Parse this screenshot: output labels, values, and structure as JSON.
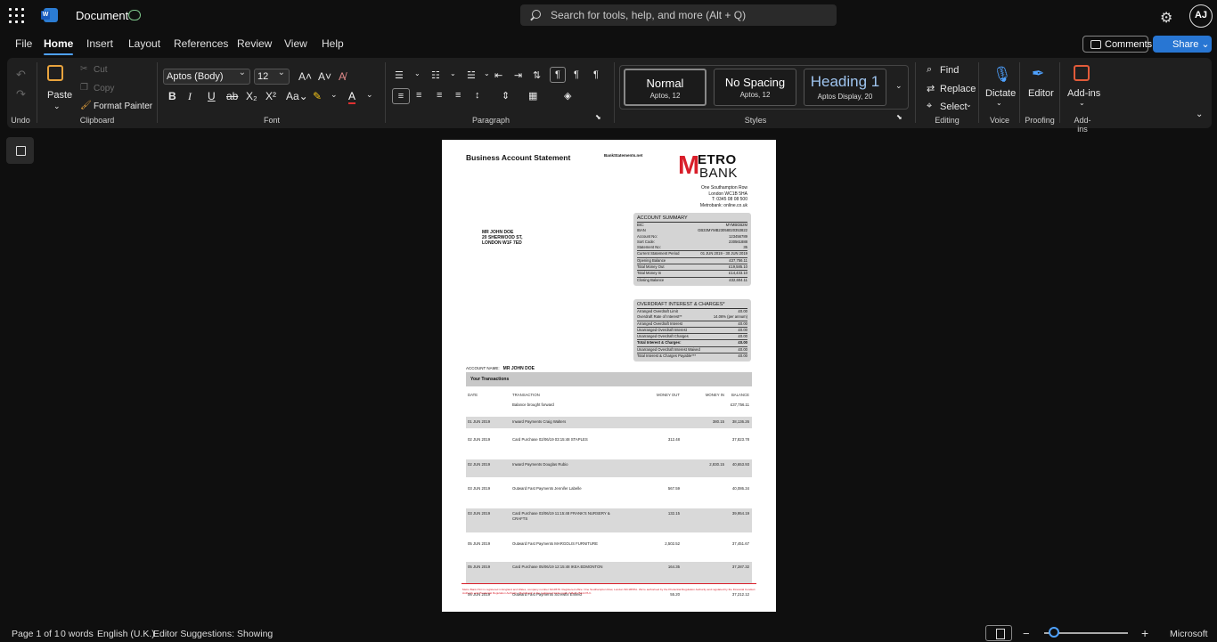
{
  "app": {
    "doc_title": "Document",
    "search_placeholder": "Search for tools, help, and more (Alt + Q)",
    "avatar": "AJ",
    "brand_color": "#2876d3"
  },
  "tabs": [
    "File",
    "Home",
    "Insert",
    "Layout",
    "References",
    "Review",
    "View",
    "Help"
  ],
  "active_tab": "Home",
  "top_buttons": {
    "comments": "Comments",
    "share": "Share"
  },
  "ribbon": {
    "undo_group": "Undo",
    "clipboard": {
      "paste": "Paste",
      "cut": "Cut",
      "copy": "Copy",
      "format_painter": "Format Painter",
      "label": "Clipboard"
    },
    "font": {
      "family": "Aptos (Body)",
      "size": "12",
      "label": "Font"
    },
    "paragraph": {
      "label": "Paragraph"
    },
    "styles": {
      "label": "Styles",
      "items": [
        {
          "name": "Normal",
          "sub": "Aptos, 12"
        },
        {
          "name": "No Spacing",
          "sub": "Aptos, 12"
        },
        {
          "name": "Heading 1",
          "sub": "Aptos Display, 20"
        }
      ]
    },
    "editing": {
      "find": "Find",
      "replace": "Replace",
      "select": "Select",
      "label": "Editing"
    },
    "voice": {
      "dictate": "Dictate",
      "label": "Voice"
    },
    "proofing": {
      "editor": "Editor",
      "label": "Proofing"
    },
    "addins": {
      "addins": "Add-ins",
      "label": "Add-ins"
    }
  },
  "statement": {
    "title": "Business Account Statement",
    "watermark": "BankStatements.net",
    "logo_m": "M",
    "logo_etro": "ETRO",
    "logo_bank": "BANK",
    "address": [
      "One Southampton Row",
      "London WC1B 5HA",
      "T: 0345 08 08 500",
      "Metrobank:  online.co.uk"
    ],
    "customer": [
      "MR JOHN DOE",
      "20 SHERWOOD ST,",
      "LONDON W1F 7ED"
    ],
    "summary": {
      "heading": "ACCOUNT SUMMARY",
      "details": [
        [
          "BIC:",
          "MYMBGB2M"
        ],
        [
          "IBAN",
          "GB33MYMB23058020353822"
        ],
        [
          "Account No:",
          "123456789"
        ],
        [
          "Sort Code:",
          "230561888"
        ],
        [
          "Statement No:",
          "35"
        ]
      ],
      "period_label": "Current Statement Period",
      "period_value": "01 JUN 2019 - 30 JUN 2019",
      "totals": [
        [
          "Opening Balance",
          "£37,756.11"
        ],
        [
          "Total Money Out",
          "£19,585.10"
        ],
        [
          "Total Money In",
          "£14,433.10"
        ],
        [
          "Closing Balance",
          "£32,604.11"
        ]
      ]
    },
    "overdraft": {
      "heading": "OVERDRAFT INTEREST & CHARGES*",
      "rows": [
        [
          "Arranged Overdraft Limit",
          "£0.00",
          false
        ],
        [
          "Overdraft Rate of Interest**",
          "14.06% (per annum)",
          false
        ],
        [
          "Arranged Overdraft Interest",
          "£0.00",
          false
        ],
        [
          "Unarranged Overdraft Interest",
          "£0.00",
          false
        ],
        [
          "Unarranged Overdraft Charges",
          "£0.00",
          false
        ],
        [
          "Total Interest & Charges:",
          "£0.00",
          true
        ],
        [
          "Unarranged Overdraft Interest Waived",
          "£0.00",
          false
        ],
        [
          "Total Interest & Charges Payable***",
          "£0.00",
          false
        ]
      ]
    },
    "account_name_label": "ACCOUNT NAME:",
    "account_name": "MR JOHN DOE",
    "tx_heading": "Your Transactions",
    "tx_columns": [
      "DATE",
      "TRANSACTION",
      "MONEY OUT",
      "MONEY IN",
      "BALANCE"
    ],
    "transactions": [
      {
        "date": "",
        "desc": "Balance brought forward",
        "out": "",
        "in": "",
        "bal": "£37,756.11",
        "shade": false,
        "h": 12
      },
      {
        "date": "01 JUN 2019",
        "desc": "Inward Payments Craig Walters",
        "out": "",
        "in": "380.15",
        "bal": "38,136.26",
        "shade": true,
        "h": 13
      },
      {
        "date": "02 JUN 2019",
        "desc": "Card Purchase 02/06/19 03:15:48 STAPLES",
        "out": "312.48",
        "in": "",
        "bal": "37,823.78",
        "shade": false,
        "h": 21
      },
      {
        "date": "02 JUN 2019",
        "desc": "Inward Payments Douglas Rubio",
        "out": "",
        "in": "2,830.15",
        "bal": "40,653.93",
        "shade": true,
        "h": 20
      },
      {
        "date": "03 JUN 2019",
        "desc": "Outward Fast Payments Jennifer Labelle",
        "out": "567.59",
        "in": "",
        "bal": "40,086.34",
        "shade": false,
        "h": 21
      },
      {
        "date": "03 JUN 2019",
        "desc": "Card Purchase 03/06/19 11:15:48 FRANK'S NURSERY & CRAFTS",
        "out": "132.15",
        "in": "",
        "bal": "39,954.19",
        "shade": true,
        "h": 27
      },
      {
        "date": "05 JUN 2019",
        "desc": "Outward Fast Payments MARGOLIS FURNITURE",
        "out": "2,502.52",
        "in": "",
        "bal": "37,451.67",
        "shade": false,
        "h": 19
      },
      {
        "date": "05 JUN 2019",
        "desc": "Card Purchase 05/06/19 12:15:48 IKEA EDMONTON",
        "out": "164.35",
        "in": "",
        "bal": "37,287.32",
        "shade": true,
        "h": 24
      },
      {
        "date": "06 JUN 2019",
        "desc": "Outward Fast Payments Screwfix Enfield",
        "out": "55.20",
        "in": "",
        "bal": "37,212.12",
        "shade": false,
        "h": 14
      }
    ],
    "footer": "Metro Bank PLC is registered in England and Wales, company number 6419578. Registered office: One Southampton Row, London WC1B5HA. We're authorised by the Prudential Regulation Authority and regulated by the Financial Conduct Authority and Prudential Regulation Authority. 'Metrobank' is the registered trade mark of Metro Bank PLC."
  },
  "status": {
    "page": "Page 1 of 1",
    "words": "0 words",
    "language": "English (U.K.)",
    "editor": "Editor Suggestions: Showing",
    "right": "Microsoft"
  }
}
